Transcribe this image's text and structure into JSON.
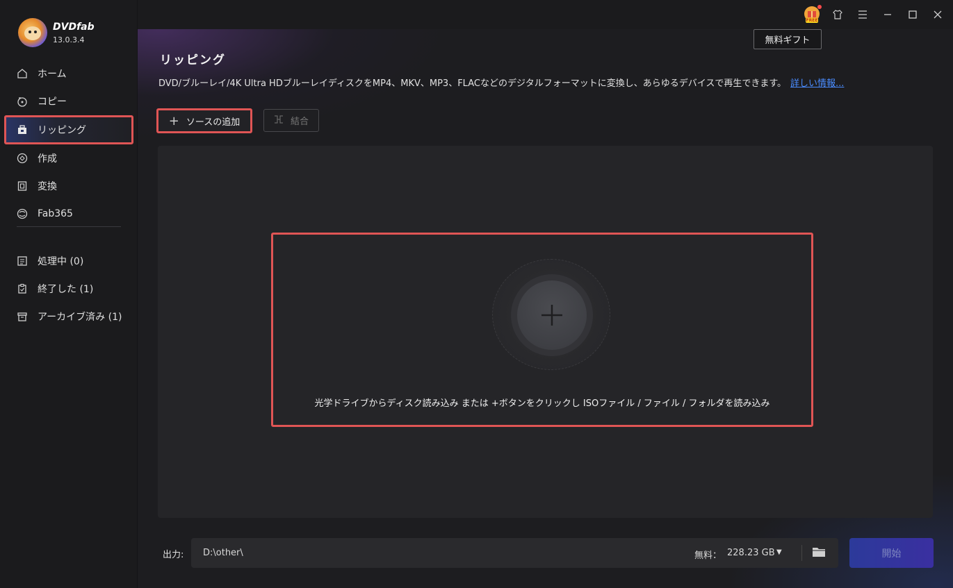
{
  "app": {
    "brand": "DVDfab",
    "version": "13.0.3.4"
  },
  "sidebar": {
    "items": [
      {
        "label": "ホーム",
        "icon": "home-icon"
      },
      {
        "label": "コピー",
        "icon": "copy-disc-icon"
      },
      {
        "label": "リッピング",
        "icon": "ripper-icon",
        "active": true
      },
      {
        "label": "作成",
        "icon": "creator-disc-icon"
      },
      {
        "label": "変換",
        "icon": "film-convert-icon"
      },
      {
        "label": "Fab365",
        "icon": "fab365-icon"
      }
    ],
    "task_items": [
      {
        "label": "処理中 (0)",
        "icon": "queue-list-icon"
      },
      {
        "label": "終了した (1)",
        "icon": "finished-clipboard-icon"
      },
      {
        "label": "アーカイブ済み (1)",
        "icon": "archive-box-icon"
      }
    ]
  },
  "topbar": {
    "free_badge": "FREE",
    "tooltip": "無料ギフト"
  },
  "main": {
    "title": "リッピング",
    "description": "DVD/ブルーレイ/4K Ultra HDブルーレイディスクをMP4、MKV、MP3、FLACなどのデジタルフォーマットに変換し、あらゆるデバイスで再生できます。",
    "more_link": "詳しい情報...",
    "add_source_label": "ソースの追加",
    "merge_label": "結合",
    "drop_hint": "光学ドライブからディスク読み込み または +ボタンをクリックし ISOファイル / ファイル / フォルダを読み込み"
  },
  "output": {
    "label": "出力:",
    "path": "D:\\other\\",
    "free_label": "無料：",
    "free_value": "228.23 GB",
    "start_label": "開始"
  },
  "colors": {
    "highlight": "#e05555",
    "link": "#4a8cff",
    "start_button": "#2c3a9a"
  }
}
